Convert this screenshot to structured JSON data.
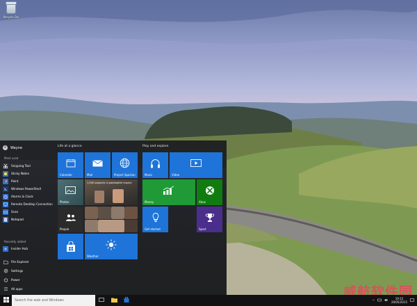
{
  "desktop": {
    "recycle_bin_label": "Recycle Bin",
    "watermark_text": "威航软件园"
  },
  "start_menu": {
    "user_name": "Wayne",
    "most_used_header": "Most used",
    "most_used": [
      {
        "label": "Snipping Tool",
        "icon": "scissors-icon"
      },
      {
        "label": "Sticky Notes",
        "icon": "sticky-note-icon"
      },
      {
        "label": "Paint",
        "icon": "paint-icon"
      },
      {
        "label": "Windows PowerShell",
        "icon": "powershell-icon"
      },
      {
        "label": "Alarms & Clock",
        "icon": "alarm-icon"
      },
      {
        "label": "Remote Desktop Connection",
        "icon": "remote-desktop-icon"
      },
      {
        "label": "Scan",
        "icon": "scan-icon"
      },
      {
        "label": "Notepad",
        "icon": "notepad-icon"
      }
    ],
    "recently_added_header": "Recently added",
    "recently_added": [
      {
        "label": "Insider Hub",
        "icon": "insider-hub-icon"
      }
    ],
    "system_items": [
      {
        "label": "File Explorer",
        "icon": "folder-icon"
      },
      {
        "label": "Settings",
        "icon": "gear-icon"
      },
      {
        "label": "Power",
        "icon": "power-icon"
      },
      {
        "label": "All apps",
        "icon": "list-icon"
      }
    ],
    "groups": {
      "life": "Life at a glance",
      "play": "Play and explore"
    },
    "tiles": {
      "calendar": "Calendar",
      "mail": "Mail",
      "project_spartan": "Project Spartan",
      "photos": "Photos",
      "news_headline": "1,000 suspects in paedophile inquiry",
      "people": "People",
      "store": "",
      "weather": "Weather",
      "music": "Music",
      "video": "Video",
      "money": "Money",
      "xbox": "Xbox",
      "get_started": "Get started",
      "sport": "Sport"
    }
  },
  "taskbar": {
    "search_placeholder": "Search the web and Windows",
    "time": "19:12",
    "date": "20/05/2015"
  },
  "colors": {
    "tile_blue": "#1e74d8",
    "tile_green": "#1f9a36",
    "xbox_green": "#107c10",
    "sport_purple": "#4a2e8c",
    "start_bg": "#1c1c20",
    "taskbar_bg": "#121214"
  }
}
